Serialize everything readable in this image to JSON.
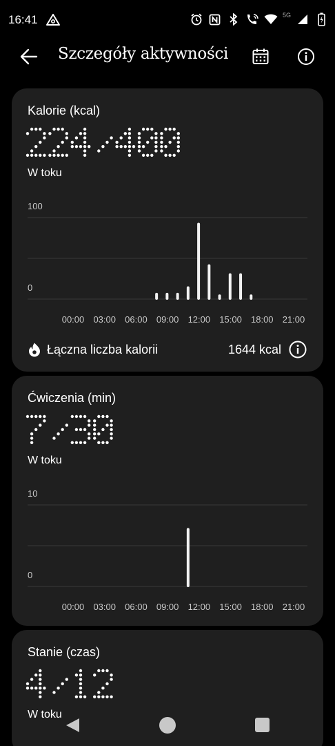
{
  "status_bar": {
    "time": "16:41",
    "network_label": "5G",
    "icons": [
      "alarm-icon",
      "nfc-icon",
      "bluetooth-icon",
      "wifi-calling-icon",
      "wifi-icon",
      "signal-icon",
      "battery-icon"
    ]
  },
  "app_bar": {
    "title": "Szczegóły aktywności",
    "icons": [
      "back-arrow-icon",
      "calendar-icon",
      "info-icon"
    ]
  },
  "calories_card": {
    "title": "Kalorie (kcal)",
    "value": "224/400",
    "status": "W toku",
    "total_label": "Łączna liczba kalorii",
    "total_value": "1644 kcal",
    "chart_data": {
      "type": "bar",
      "x": [
        "00:00",
        "00:30",
        "01:00",
        "01:30",
        "02:00",
        "02:30",
        "03:00",
        "03:30",
        "04:00",
        "04:30",
        "05:00",
        "05:30",
        "06:00",
        "06:30",
        "07:00",
        "07:30",
        "08:00",
        "08:30",
        "09:00",
        "09:30",
        "10:00",
        "10:30",
        "11:00",
        "11:30",
        "12:00",
        "12:30",
        "13:00",
        "13:30",
        "14:00",
        "14:30",
        "15:00",
        "15:30",
        "16:00",
        "16:30",
        "17:00",
        "17:30",
        "18:00",
        "18:30",
        "19:00",
        "19:30",
        "20:00",
        "20:30",
        "21:00",
        "21:30",
        "22:00",
        "22:30",
        "23:00",
        "23:30"
      ],
      "values": [
        0,
        0,
        0,
        0,
        0,
        0,
        0,
        0,
        0,
        0,
        0,
        0,
        0,
        0,
        0,
        0,
        0,
        0,
        6,
        0,
        6,
        0,
        6,
        0,
        14,
        0,
        92,
        0,
        41,
        0,
        4,
        0,
        30,
        0,
        30,
        0,
        4,
        0,
        0,
        0,
        0,
        0,
        0,
        0,
        0,
        0,
        0,
        0
      ],
      "tick_labels": [
        "00:00",
        "03:00",
        "06:00",
        "09:00",
        "12:00",
        "15:00",
        "18:00",
        "21:00"
      ],
      "y_tick_labels": [
        "100",
        "0"
      ],
      "ylim": [
        0,
        100
      ],
      "grid": true
    }
  },
  "exercise_card": {
    "title": "Ćwiczenia (min)",
    "value": "7/30",
    "status": "W toku",
    "chart_data": {
      "type": "bar",
      "x": [
        "12:00"
      ],
      "values": [
        7
      ],
      "tick_labels": [
        "00:00",
        "03:00",
        "06:00",
        "09:00",
        "12:00",
        "15:00",
        "18:00",
        "21:00"
      ],
      "y_tick_labels": [
        "10",
        "0"
      ],
      "ylim": [
        0,
        10
      ],
      "grid": true
    }
  },
  "standing_card": {
    "title": "Stanie (czas)",
    "value": "4/12",
    "status": "W toku"
  },
  "nav_bar": {
    "icons": [
      "nav-back-icon",
      "nav-home-icon",
      "nav-recents-icon"
    ]
  }
}
